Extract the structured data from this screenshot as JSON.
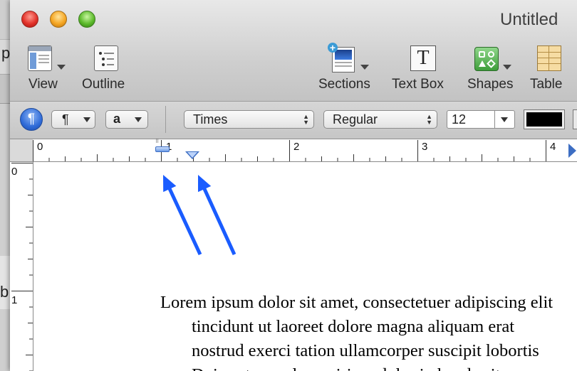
{
  "background_window": {
    "char_top": "p",
    "char_bottom": "b"
  },
  "window": {
    "title": "Untitled"
  },
  "toolbar": {
    "view_label": "View",
    "outline_label": "Outline",
    "sections_label": "Sections",
    "textbox_label": "Text Box",
    "shapes_label": "Shapes",
    "table_label": "Table",
    "textbox_glyph": "T"
  },
  "format_bar": {
    "paragraph_glyph": "¶",
    "paragraph_style_glyph": "¶",
    "char_style_glyph": "a",
    "font_family": "Times",
    "typeface": "Regular",
    "font_size": "12",
    "text_color": "#000000"
  },
  "ruler": {
    "marks": [
      "0",
      "1",
      "2",
      "3",
      "4"
    ]
  },
  "vertical_ruler": {
    "marks": [
      "0",
      "1"
    ]
  },
  "annotation_color": "#1a5cff",
  "document": {
    "lines": [
      "Lorem ipsum dolor sit amet, consectetuer adipiscing elit",
      "tincidunt ut laoreet dolore magna aliquam erat",
      "nostrud exerci tation ullamcorper suscipit lobortis",
      "Duis autem vel eum iriure dolor in hendrerit"
    ]
  }
}
